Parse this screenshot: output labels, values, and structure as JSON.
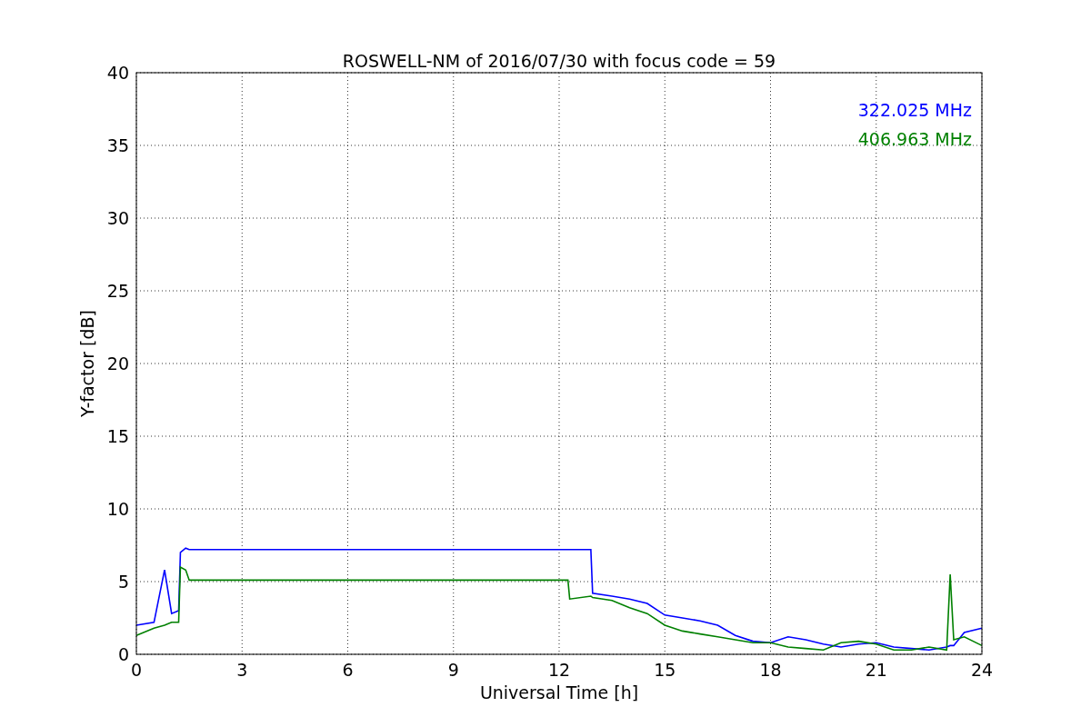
{
  "chart_data": {
    "type": "line",
    "title": "ROSWELL-NM of 2016/07/30 with focus code = 59",
    "xlabel": "Universal Time [h]",
    "ylabel": "Y-factor [dB]",
    "x": [
      0,
      0.5,
      0.8,
      1.0,
      1.2,
      1.25,
      1.4,
      1.5,
      12.25,
      12.3,
      12.9,
      12.95,
      13.5,
      14,
      14.5,
      15,
      15.5,
      16,
      16.5,
      17,
      17.5,
      18,
      18.5,
      19,
      19.5,
      20,
      20.5,
      21,
      21.5,
      22,
      22.5,
      23,
      23.1,
      23.2,
      23.5,
      24
    ],
    "series": [
      {
        "name": "322.025 MHz",
        "color": "#0000ff",
        "values": [
          2.0,
          2.2,
          5.8,
          2.8,
          3.0,
          7.0,
          7.3,
          7.2,
          7.2,
          7.2,
          7.2,
          4.2,
          4.0,
          3.8,
          3.5,
          2.7,
          2.5,
          2.3,
          2.0,
          1.3,
          0.9,
          0.8,
          1.2,
          1.0,
          0.7,
          0.5,
          0.7,
          0.8,
          0.5,
          0.4,
          0.3,
          0.5,
          0.6,
          0.6,
          1.5,
          1.8
        ]
      },
      {
        "name": "406.963 MHz",
        "color": "#008000",
        "values": [
          1.3,
          1.8,
          2.0,
          2.2,
          2.2,
          6.0,
          5.8,
          5.1,
          5.1,
          3.8,
          4.0,
          3.9,
          3.7,
          3.2,
          2.8,
          2.0,
          1.6,
          1.4,
          1.2,
          1.0,
          0.8,
          0.8,
          0.5,
          0.4,
          0.3,
          0.8,
          0.9,
          0.7,
          0.3,
          0.3,
          0.5,
          0.3,
          5.5,
          1.0,
          1.2,
          0.6
        ]
      }
    ],
    "xlim": [
      0,
      24
    ],
    "ylim": [
      0,
      40
    ],
    "xticks": [
      0,
      3,
      6,
      9,
      12,
      15,
      18,
      21,
      24
    ],
    "yticks": [
      0,
      5,
      10,
      15,
      20,
      25,
      30,
      35,
      40
    ],
    "grid": true
  }
}
